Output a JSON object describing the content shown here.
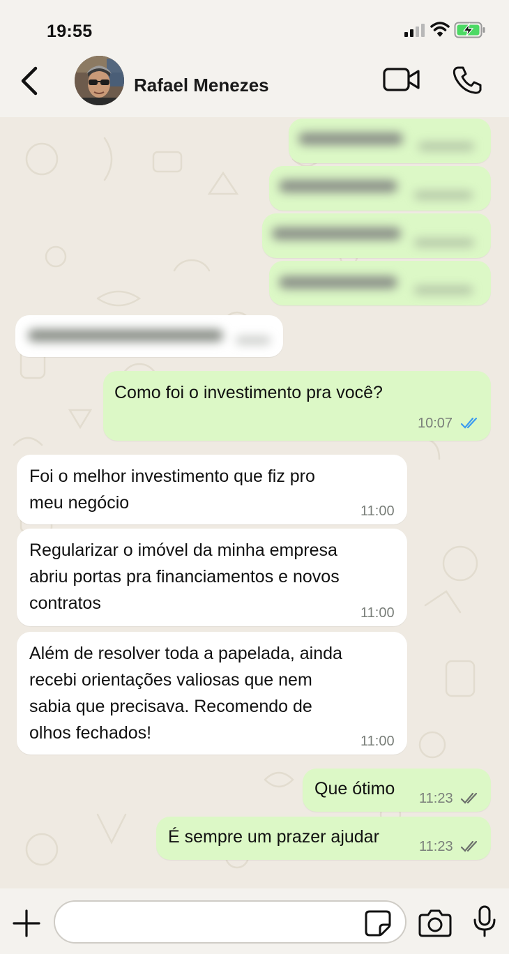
{
  "status_bar": {
    "time": "19:55"
  },
  "header": {
    "contact_name": "Rafael Menezes"
  },
  "messages": [
    {
      "text": "Como foi o investimento pra você?",
      "time": "10:07",
      "read": true
    },
    {
      "text": "Foi o melhor investimento que fiz pro\nmeu negócio",
      "time": "11:00"
    },
    {
      "text": "Regularizar o imóvel da minha empresa\nabriu portas pra financiamentos e novos\ncontratos",
      "time": "11:00"
    },
    {
      "text": "Além de resolver toda a papelada, ainda\nrecebi orientações valiosas que nem\nsabia que precisava. Recomendo de\nolhos fechados!",
      "time": "11:00"
    },
    {
      "text": "Que ótimo",
      "time": "11:23",
      "read": false
    },
    {
      "text": "É sempre um prazer ajudar",
      "time": "11:23",
      "read": false
    }
  ],
  "colors": {
    "outgoing_bubble": "#dcf8c6",
    "incoming_bubble": "#ffffff",
    "read_ticks": "#3b9bf0",
    "chat_background": "#efeae2"
  },
  "icons": [
    "back-icon",
    "video-call-icon",
    "phone-icon",
    "plus-icon",
    "sticker-icon",
    "camera-icon",
    "microphone-icon",
    "double-check-icon"
  ]
}
